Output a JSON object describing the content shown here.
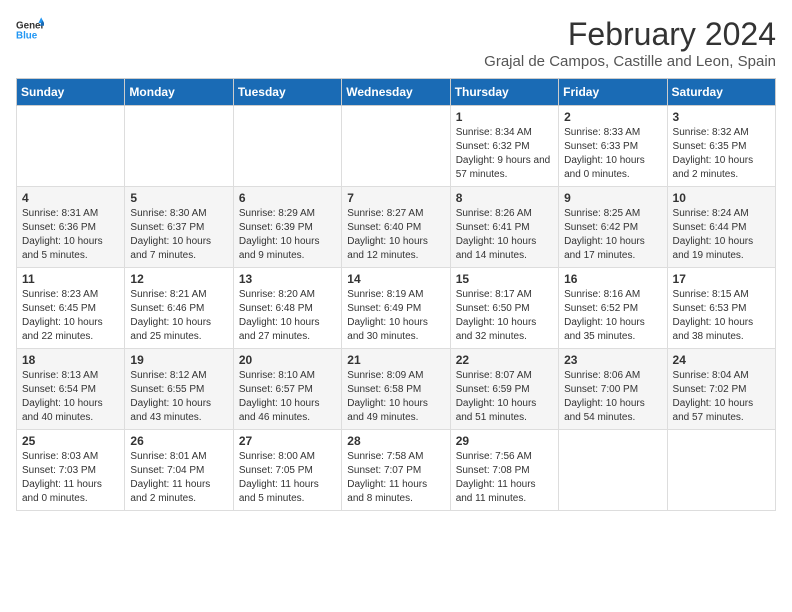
{
  "header": {
    "logo_general": "General",
    "logo_blue": "Blue",
    "main_title": "February 2024",
    "subtitle": "Grajal de Campos, Castille and Leon, Spain"
  },
  "calendar": {
    "days_of_week": [
      "Sunday",
      "Monday",
      "Tuesday",
      "Wednesday",
      "Thursday",
      "Friday",
      "Saturday"
    ],
    "weeks": [
      [
        {
          "day": "",
          "info": ""
        },
        {
          "day": "",
          "info": ""
        },
        {
          "day": "",
          "info": ""
        },
        {
          "day": "",
          "info": ""
        },
        {
          "day": "1",
          "info": "Sunrise: 8:34 AM\nSunset: 6:32 PM\nDaylight: 9 hours and 57 minutes."
        },
        {
          "day": "2",
          "info": "Sunrise: 8:33 AM\nSunset: 6:33 PM\nDaylight: 10 hours and 0 minutes."
        },
        {
          "day": "3",
          "info": "Sunrise: 8:32 AM\nSunset: 6:35 PM\nDaylight: 10 hours and 2 minutes."
        }
      ],
      [
        {
          "day": "4",
          "info": "Sunrise: 8:31 AM\nSunset: 6:36 PM\nDaylight: 10 hours and 5 minutes."
        },
        {
          "day": "5",
          "info": "Sunrise: 8:30 AM\nSunset: 6:37 PM\nDaylight: 10 hours and 7 minutes."
        },
        {
          "day": "6",
          "info": "Sunrise: 8:29 AM\nSunset: 6:39 PM\nDaylight: 10 hours and 9 minutes."
        },
        {
          "day": "7",
          "info": "Sunrise: 8:27 AM\nSunset: 6:40 PM\nDaylight: 10 hours and 12 minutes."
        },
        {
          "day": "8",
          "info": "Sunrise: 8:26 AM\nSunset: 6:41 PM\nDaylight: 10 hours and 14 minutes."
        },
        {
          "day": "9",
          "info": "Sunrise: 8:25 AM\nSunset: 6:42 PM\nDaylight: 10 hours and 17 minutes."
        },
        {
          "day": "10",
          "info": "Sunrise: 8:24 AM\nSunset: 6:44 PM\nDaylight: 10 hours and 19 minutes."
        }
      ],
      [
        {
          "day": "11",
          "info": "Sunrise: 8:23 AM\nSunset: 6:45 PM\nDaylight: 10 hours and 22 minutes."
        },
        {
          "day": "12",
          "info": "Sunrise: 8:21 AM\nSunset: 6:46 PM\nDaylight: 10 hours and 25 minutes."
        },
        {
          "day": "13",
          "info": "Sunrise: 8:20 AM\nSunset: 6:48 PM\nDaylight: 10 hours and 27 minutes."
        },
        {
          "day": "14",
          "info": "Sunrise: 8:19 AM\nSunset: 6:49 PM\nDaylight: 10 hours and 30 minutes."
        },
        {
          "day": "15",
          "info": "Sunrise: 8:17 AM\nSunset: 6:50 PM\nDaylight: 10 hours and 32 minutes."
        },
        {
          "day": "16",
          "info": "Sunrise: 8:16 AM\nSunset: 6:52 PM\nDaylight: 10 hours and 35 minutes."
        },
        {
          "day": "17",
          "info": "Sunrise: 8:15 AM\nSunset: 6:53 PM\nDaylight: 10 hours and 38 minutes."
        }
      ],
      [
        {
          "day": "18",
          "info": "Sunrise: 8:13 AM\nSunset: 6:54 PM\nDaylight: 10 hours and 40 minutes."
        },
        {
          "day": "19",
          "info": "Sunrise: 8:12 AM\nSunset: 6:55 PM\nDaylight: 10 hours and 43 minutes."
        },
        {
          "day": "20",
          "info": "Sunrise: 8:10 AM\nSunset: 6:57 PM\nDaylight: 10 hours and 46 minutes."
        },
        {
          "day": "21",
          "info": "Sunrise: 8:09 AM\nSunset: 6:58 PM\nDaylight: 10 hours and 49 minutes."
        },
        {
          "day": "22",
          "info": "Sunrise: 8:07 AM\nSunset: 6:59 PM\nDaylight: 10 hours and 51 minutes."
        },
        {
          "day": "23",
          "info": "Sunrise: 8:06 AM\nSunset: 7:00 PM\nDaylight: 10 hours and 54 minutes."
        },
        {
          "day": "24",
          "info": "Sunrise: 8:04 AM\nSunset: 7:02 PM\nDaylight: 10 hours and 57 minutes."
        }
      ],
      [
        {
          "day": "25",
          "info": "Sunrise: 8:03 AM\nSunset: 7:03 PM\nDaylight: 11 hours and 0 minutes."
        },
        {
          "day": "26",
          "info": "Sunrise: 8:01 AM\nSunset: 7:04 PM\nDaylight: 11 hours and 2 minutes."
        },
        {
          "day": "27",
          "info": "Sunrise: 8:00 AM\nSunset: 7:05 PM\nDaylight: 11 hours and 5 minutes."
        },
        {
          "day": "28",
          "info": "Sunrise: 7:58 AM\nSunset: 7:07 PM\nDaylight: 11 hours and 8 minutes."
        },
        {
          "day": "29",
          "info": "Sunrise: 7:56 AM\nSunset: 7:08 PM\nDaylight: 11 hours and 11 minutes."
        },
        {
          "day": "",
          "info": ""
        },
        {
          "day": "",
          "info": ""
        }
      ]
    ]
  }
}
